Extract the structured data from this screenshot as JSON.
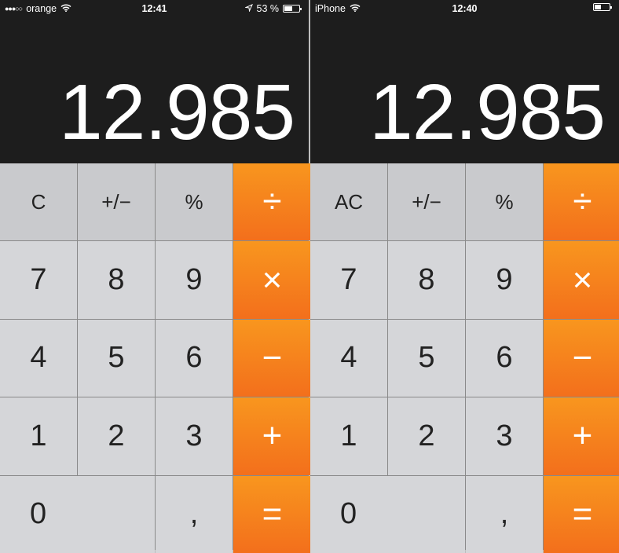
{
  "accent_color": "#f7931e",
  "panels": [
    {
      "status": {
        "signal": "●●●○○",
        "carrier": "orange",
        "wifi_icon": "wifi-icon",
        "time": "12:41",
        "location_icon": "location-arrow-icon",
        "battery": "53 %",
        "battery_level": 0.53
      },
      "display": "12.985",
      "keys": [
        "C",
        "+/−",
        "%",
        "÷",
        "7",
        "8",
        "9",
        "×",
        "4",
        "5",
        "6",
        "−",
        "1",
        "2",
        "3",
        "+",
        "0",
        ",",
        "="
      ]
    },
    {
      "status": {
        "signal": "",
        "carrier": "iPhone",
        "wifi_icon": "wifi-icon",
        "time": "12:40",
        "location_icon": "",
        "battery": "",
        "battery_level": 0.4
      },
      "display": "12.985",
      "keys": [
        "AC",
        "+/−",
        "%",
        "÷",
        "7",
        "8",
        "9",
        "×",
        "4",
        "5",
        "6",
        "−",
        "1",
        "2",
        "3",
        "+",
        "0",
        ",",
        "="
      ]
    }
  ]
}
